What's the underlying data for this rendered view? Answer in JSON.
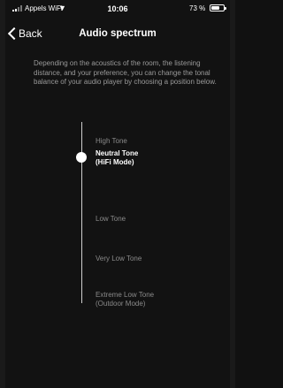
{
  "status_bar": {
    "carrier": "Appels WiFi",
    "wifi_icon": "wifi-icon",
    "time": "10:06",
    "battery_percent": "73 %",
    "battery_level": 0.73
  },
  "nav": {
    "back_label": "Back",
    "title": "Audio spectrum"
  },
  "intro_text": "Depending on the acoustics of the room, the listening distance, and your preference, you can change the tonal balance of your audio player by choosing a position below.",
  "tone_options": [
    {
      "line1": "High Tone",
      "line2": ""
    },
    {
      "line1": "Neutral Tone",
      "line2": "(HiFi Mode)"
    },
    {
      "line1": "Low Tone",
      "line2": ""
    },
    {
      "line1": "Very Low Tone",
      "line2": ""
    },
    {
      "line1": "Extreme Low Tone",
      "line2": "(Outdoor Mode)"
    }
  ],
  "selected_index": 1,
  "colors": {
    "background": "#121212",
    "text_primary": "#ffffff",
    "text_secondary": "#9a9a9a",
    "track": "#cfcfcf"
  }
}
